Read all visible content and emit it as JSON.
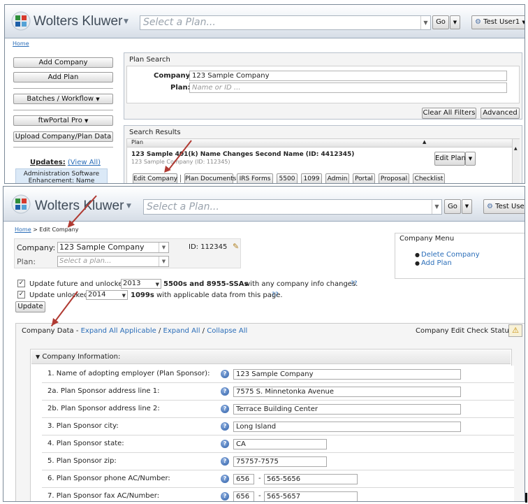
{
  "top": {
    "header": {
      "brand": "Wolters Kluwer",
      "plan_placeholder": "Select a Plan...",
      "go_label": "Go",
      "user_label": "Test User1"
    },
    "breadcrumb": {
      "home": "Home"
    },
    "sidebar": {
      "add_company": "Add Company",
      "add_plan": "Add Plan",
      "batches": "Batches / Workflow",
      "ftwportal": "ftwPortal Pro",
      "upload": "Upload Company/Plan Data",
      "updates_label": "Updates:",
      "view_all": "(View All)",
      "update_item": "Administration Software Enhancement: Name"
    },
    "plan_search": {
      "title": "Plan Search",
      "company_label": "Company:",
      "company_value": "123 Sample Company",
      "plan_label": "Plan:",
      "plan_placeholder": "Name or ID ...",
      "clear_filters": "Clear All Filters",
      "advanced": "Advanced"
    },
    "search_results": {
      "title": "Search Results",
      "column": "Plan",
      "result_name": "123 Sample 401(k) Name Changes Second Name (ID: 4412345)",
      "result_sub": "123 Sample Company (ID: 112345)",
      "edit_plan": "Edit Plan",
      "buttons": [
        "Edit Company",
        "Plan Documents",
        "IRS Forms",
        "5500",
        "1099",
        "Admin",
        "Portal",
        "Proposal",
        "Checklist"
      ]
    }
  },
  "bottom": {
    "header": {
      "brand": "Wolters Kluwer",
      "plan_placeholder": "Select a Plan...",
      "go_label": "Go",
      "user_label": "Test User"
    },
    "breadcrumb": {
      "home": "Home",
      "current": " > Edit Company"
    },
    "selector": {
      "company_label": "Company:",
      "company_value": "123 Sample Company",
      "id_label": "ID: 112345",
      "plan_label": "Plan:",
      "plan_placeholder": "Select a plan..."
    },
    "company_menu": {
      "title": "Company Menu",
      "items": [
        "Delete Company",
        "Add Plan"
      ]
    },
    "update_options": {
      "line1_prefix": "Update future and unlocked",
      "line1_year": "2013",
      "line1_bold": "5500s and 8955-SSAs",
      "line1_suffix": "with any company info changes.",
      "line2_prefix": "Update unlocked",
      "line2_year": "2014",
      "line2_bold": "1099s",
      "line2_suffix": "with applicable data from this page.",
      "help_mark": "??",
      "update_button": "Update"
    },
    "company_data": {
      "title": "Company Data",
      "sep": " - ",
      "expand_applicable": "Expand All Applicable",
      "expand_all": "Expand All",
      "collapse_all": "Collapse All",
      "slash": " / ",
      "check_status": "Company Edit Check Status:",
      "section": "Company Information:",
      "fields": [
        {
          "label": "1. Name of adopting employer (Plan Sponsor):",
          "value": "123 Sample Company"
        },
        {
          "label": "2a. Plan Sponsor address line 1:",
          "value": "7575 S. Minnetonka Avenue"
        },
        {
          "label": "2b. Plan Sponsor address line 2:",
          "value": "Terrace Building Center"
        },
        {
          "label": "3. Plan Sponsor city:",
          "value": "Long Island"
        },
        {
          "label": "4. Plan Sponsor state:",
          "value": "CA"
        },
        {
          "label": "5. Plan Sponsor zip:",
          "value": "75757-7575"
        },
        {
          "label": "6. Plan Sponsor phone AC/Number:",
          "area": "656",
          "number": "565-5656"
        },
        {
          "label": "7. Plan Sponsor fax AC/Number:",
          "area": "656",
          "number": "565-5657"
        }
      ]
    }
  }
}
